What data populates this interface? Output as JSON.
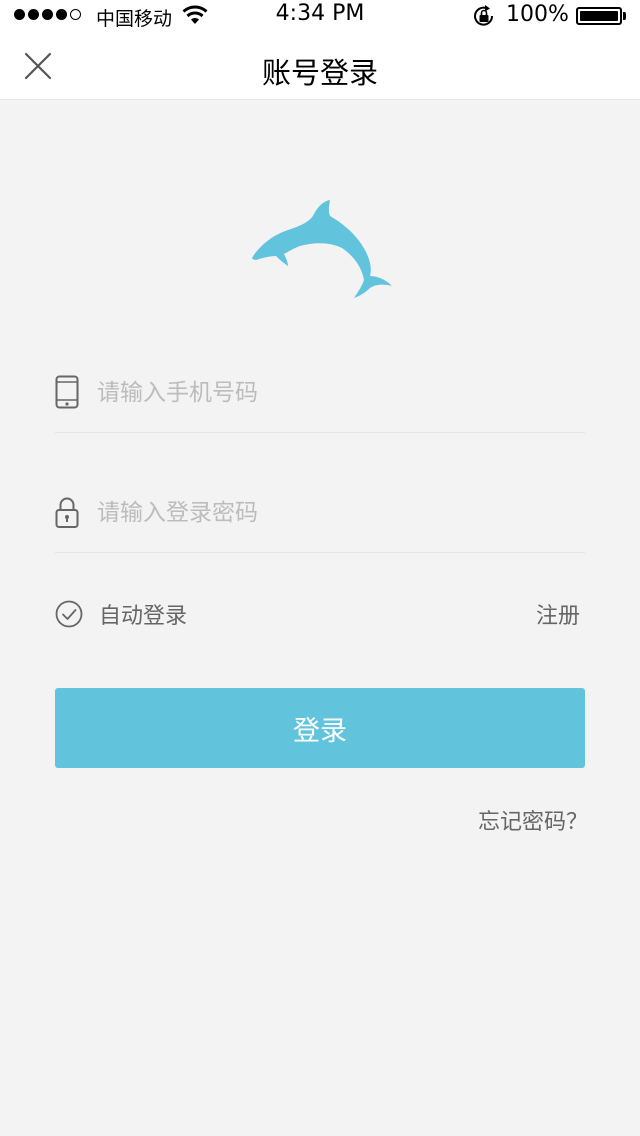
{
  "status_bar": {
    "carrier": "中国移动",
    "time": "4:34 PM",
    "battery": "100%",
    "signal_icon": "signal-dots-icon",
    "wifi_icon": "wifi-icon",
    "orientation_lock_icon": "orientation-lock-icon",
    "battery_icon": "battery-icon"
  },
  "nav": {
    "title": "账号登录",
    "close_icon": "close-icon"
  },
  "logo": {
    "icon": "dolphin-logo-icon",
    "color": "#62c4dc"
  },
  "form": {
    "phone_placeholder": "请输入手机号码",
    "phone_value": "",
    "phone_icon": "phone-icon",
    "password_placeholder": "请输入登录密码",
    "password_value": "",
    "password_icon": "lock-icon",
    "auto_login_label": "自动登录",
    "auto_login_icon": "check-circle-icon",
    "register_label": "注册",
    "login_label": "登录",
    "forgot_label": "忘记密码？"
  },
  "colors": {
    "accent": "#62c4dc",
    "background": "#f3f3f3",
    "placeholder": "#bcbcbc",
    "secondary_text": "#666666"
  }
}
